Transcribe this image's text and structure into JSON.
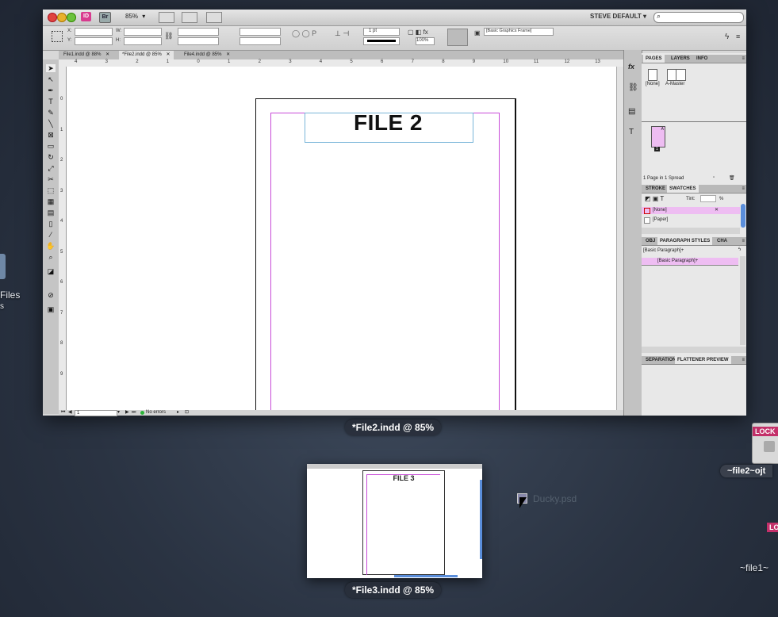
{
  "desktop": {
    "left_label": "Files",
    "left_sublabel": "s",
    "right_badge": "LOCK",
    "right_label_1": "~file2~ojt",
    "right_label_2": "~file1~",
    "right_badge_2": "LO",
    "ducky_file": "Ducky.psd"
  },
  "expose": {
    "main_caption": "*File2.indd @ 85%",
    "thumb_caption": "*File3.indd @ 85%"
  },
  "appbar": {
    "id_badge": "ID",
    "br_badge": "Br",
    "zoom": "85%",
    "workspace": "STEVE DEFAULT"
  },
  "control_panel": {
    "x_label": "X:",
    "y_label": "Y:",
    "w_label": "W:",
    "h_label": "H:",
    "stroke_weight": "1 pt",
    "opacity": "100%",
    "frame_style": "[Basic Graphics Frame]"
  },
  "doc_tabs": [
    {
      "label": "File1.indd @ 88%"
    },
    {
      "label": "*File2.indd @ 85%"
    },
    {
      "label": "File4.indd @ 85%"
    }
  ],
  "ruler": {
    "h_ticks": [
      "4",
      "3",
      "2",
      "1",
      "0",
      "1",
      "2",
      "3",
      "4",
      "5",
      "6",
      "7",
      "8",
      "9",
      "10",
      "11",
      "12",
      "13"
    ],
    "v_ticks": [
      "0",
      "1",
      "2",
      "3",
      "4",
      "5",
      "6",
      "7",
      "8",
      "9"
    ]
  },
  "document": {
    "title": "FILE 2"
  },
  "status": {
    "page": "1",
    "preflight": "No errors"
  },
  "pages_panel": {
    "tabs": [
      "PAGES",
      "LAYERS",
      "INFO"
    ],
    "master_none": "[None]",
    "master_a": "A-Master",
    "page_letter": "A",
    "page_number": "1",
    "footer": "1 Page in 1 Spread"
  },
  "swatches_panel": {
    "tabs": [
      "STROKE",
      "SWATCHES"
    ],
    "tint_label": "Tint:",
    "tint_unit": "%",
    "swatches": [
      {
        "name": "[None]"
      },
      {
        "name": "[Paper]"
      }
    ]
  },
  "para_panel": {
    "tabs": [
      "OBJ",
      "PARAGRAPH STYLES",
      "CHA"
    ],
    "current": "[Basic Paragraph]+",
    "styles": [
      {
        "name": "[Basic Paragraph]+"
      }
    ]
  },
  "bottom_panel": {
    "tabs": [
      "SEPARATION",
      "FLATTENER PREVIEW"
    ]
  },
  "thumbnail": {
    "title": "FILE 3"
  },
  "colors": {
    "margin": "#c84bd8",
    "frame": "#7ab6d9",
    "highlight": "#eebdf2",
    "indesign": "#d83b8f"
  }
}
